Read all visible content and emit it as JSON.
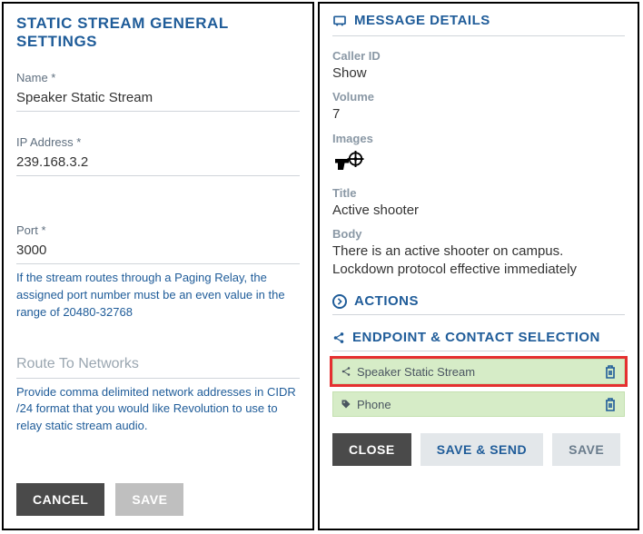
{
  "left": {
    "title": "STATIC STREAM GENERAL SETTINGS",
    "name_label": "Name *",
    "name_value": "Speaker Static Stream",
    "ip_label": "IP Address *",
    "ip_value": "239.168.3.2",
    "port_label": "Port *",
    "port_value": "3000",
    "port_help": "If the stream routes through a Paging Relay, the assigned port number must be an even value in the range of 20480-32768",
    "route_placeholder": "Route To Networks",
    "route_help": "Provide comma delimited network addresses in CIDR /24 format that you would like Revolution to use to relay static stream audio.",
    "cancel": "CANCEL",
    "save": "SAVE"
  },
  "right": {
    "header": "MESSAGE DETAILS",
    "caller_id_label": "Caller ID",
    "caller_id_value": "Show",
    "volume_label": "Volume",
    "volume_value": "7",
    "images_label": "Images",
    "title_label": "Title",
    "title_value": "Active shooter",
    "body_label": "Body",
    "body_value": "There is an active shooter on campus. Lockdown protocol effective immediately",
    "actions_header": "ACTIONS",
    "endpoint_header": "ENDPOINT & CONTACT SELECTION",
    "endpoints": [
      {
        "label": "Speaker Static Stream"
      },
      {
        "label": "Phone"
      }
    ],
    "close": "CLOSE",
    "save_send": "SAVE & SEND",
    "save": "SAVE"
  }
}
